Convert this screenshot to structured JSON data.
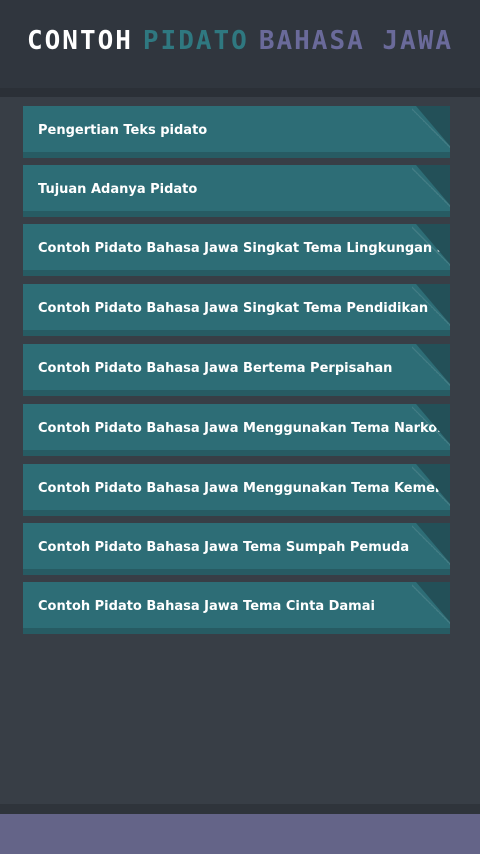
{
  "header": {
    "title_word1": "CONTOH",
    "title_word2": "PIDATO",
    "title_word3": "BAHASA JAWA"
  },
  "menu": {
    "items": [
      {
        "label": "Pengertian Teks pidato"
      },
      {
        "label": "Tujuan Adanya Pidato"
      },
      {
        "label": "Contoh Pidato Bahasa Jawa Singkat Tema Lingkungan Sekolah"
      },
      {
        "label": "Contoh Pidato Bahasa Jawa Singkat Tema Pendidikan"
      },
      {
        "label": "Contoh Pidato Bahasa Jawa Bertema Perpisahan"
      },
      {
        "label": "Contoh Pidato Bahasa Jawa Menggunakan Tema Narkoba"
      },
      {
        "label": "Contoh Pidato Bahasa Jawa Menggunakan Tema Kemerdekaan"
      },
      {
        "label": "Contoh Pidato Bahasa Jawa Tema Sumpah Pemuda"
      },
      {
        "label": "Contoh Pidato Bahasa Jawa Tema Cinta Damai"
      }
    ]
  },
  "colors": {
    "background": "#383e46",
    "header": "#30363e",
    "item": "#2d6d76",
    "item_shadow": "#275b63",
    "title_white": "#ffffff",
    "title_teal": "#2f7880",
    "title_purple": "#6a6a9a",
    "footer": "#646488"
  }
}
